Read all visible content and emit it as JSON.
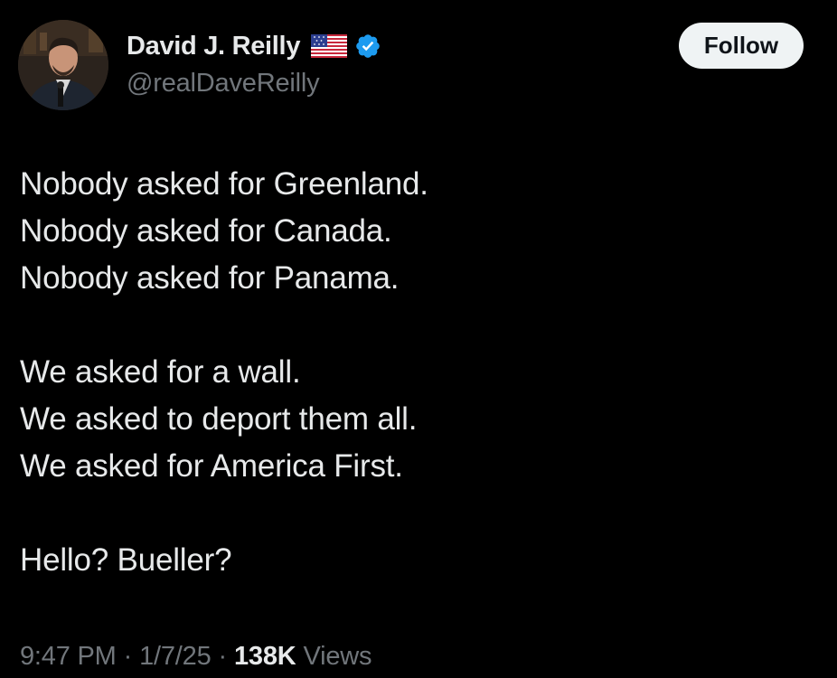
{
  "author": {
    "display_name": "David J. Reilly",
    "handle": "@realDaveReilly",
    "flag": "us-flag-icon",
    "verified": "verified-badge-icon"
  },
  "follow_label": "Follow",
  "tweet": {
    "lines_group_1": [
      "Nobody asked for Greenland.",
      "Nobody asked for Canada.",
      "Nobody asked for Panama."
    ],
    "lines_group_2": [
      "We asked for a wall.",
      "We asked to deport them all.",
      "We asked for America First."
    ],
    "lines_group_3": [
      "Hello? Bueller?"
    ]
  },
  "meta": {
    "time": "9:47 PM",
    "separator": "·",
    "date": "1/7/25",
    "views_count": "138K",
    "views_label": "Views"
  },
  "colors": {
    "background": "#000000",
    "primary_text": "#e7e9ea",
    "secondary_text": "#71767b",
    "verified_blue": "#1d9bf0",
    "follow_bg": "#eff3f4"
  }
}
